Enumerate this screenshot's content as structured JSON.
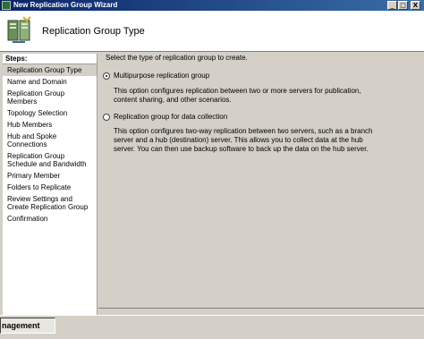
{
  "window": {
    "title": "New Replication Group Wizard",
    "controls": [
      "_",
      "□",
      "X"
    ]
  },
  "header": {
    "title": "Replication Group Type",
    "icon": "replication-wizard-icon"
  },
  "steps": {
    "heading": "Steps:",
    "items": [
      {
        "label": "Replication Group Type",
        "active": true
      },
      {
        "label": "Name and Domain"
      },
      {
        "label": "Replication Group Members"
      },
      {
        "label": "Topology Selection"
      },
      {
        "label": "Hub Members"
      },
      {
        "label": "Hub and Spoke Connections"
      },
      {
        "label": "Replication Group Schedule and Bandwidth"
      },
      {
        "label": "Primary Member"
      },
      {
        "label": "Folders to Replicate"
      },
      {
        "label": "Review Settings and Create Replication Group"
      },
      {
        "label": "Confirmation"
      }
    ]
  },
  "content": {
    "intro": "Select the type of replication group to create.",
    "options": [
      {
        "label": "Multipurpose replication group",
        "selected": true,
        "description": "This option configures replication between two or more servers for publication, content sharing, and other scenarios."
      },
      {
        "label": "Replication group for data collection",
        "selected": false,
        "description": "This option configures two-way replication between two servers, such as a branch server and a hub (destination) server. This allows you to collect data at the hub server. You can then use backup software to back up the data on the hub server."
      }
    ]
  },
  "taskbar": {
    "item_label": "nagement"
  },
  "colors": {
    "titlebar": "#0a246a",
    "face": "#d4d0c8",
    "active_step": "#d4d0c8"
  }
}
